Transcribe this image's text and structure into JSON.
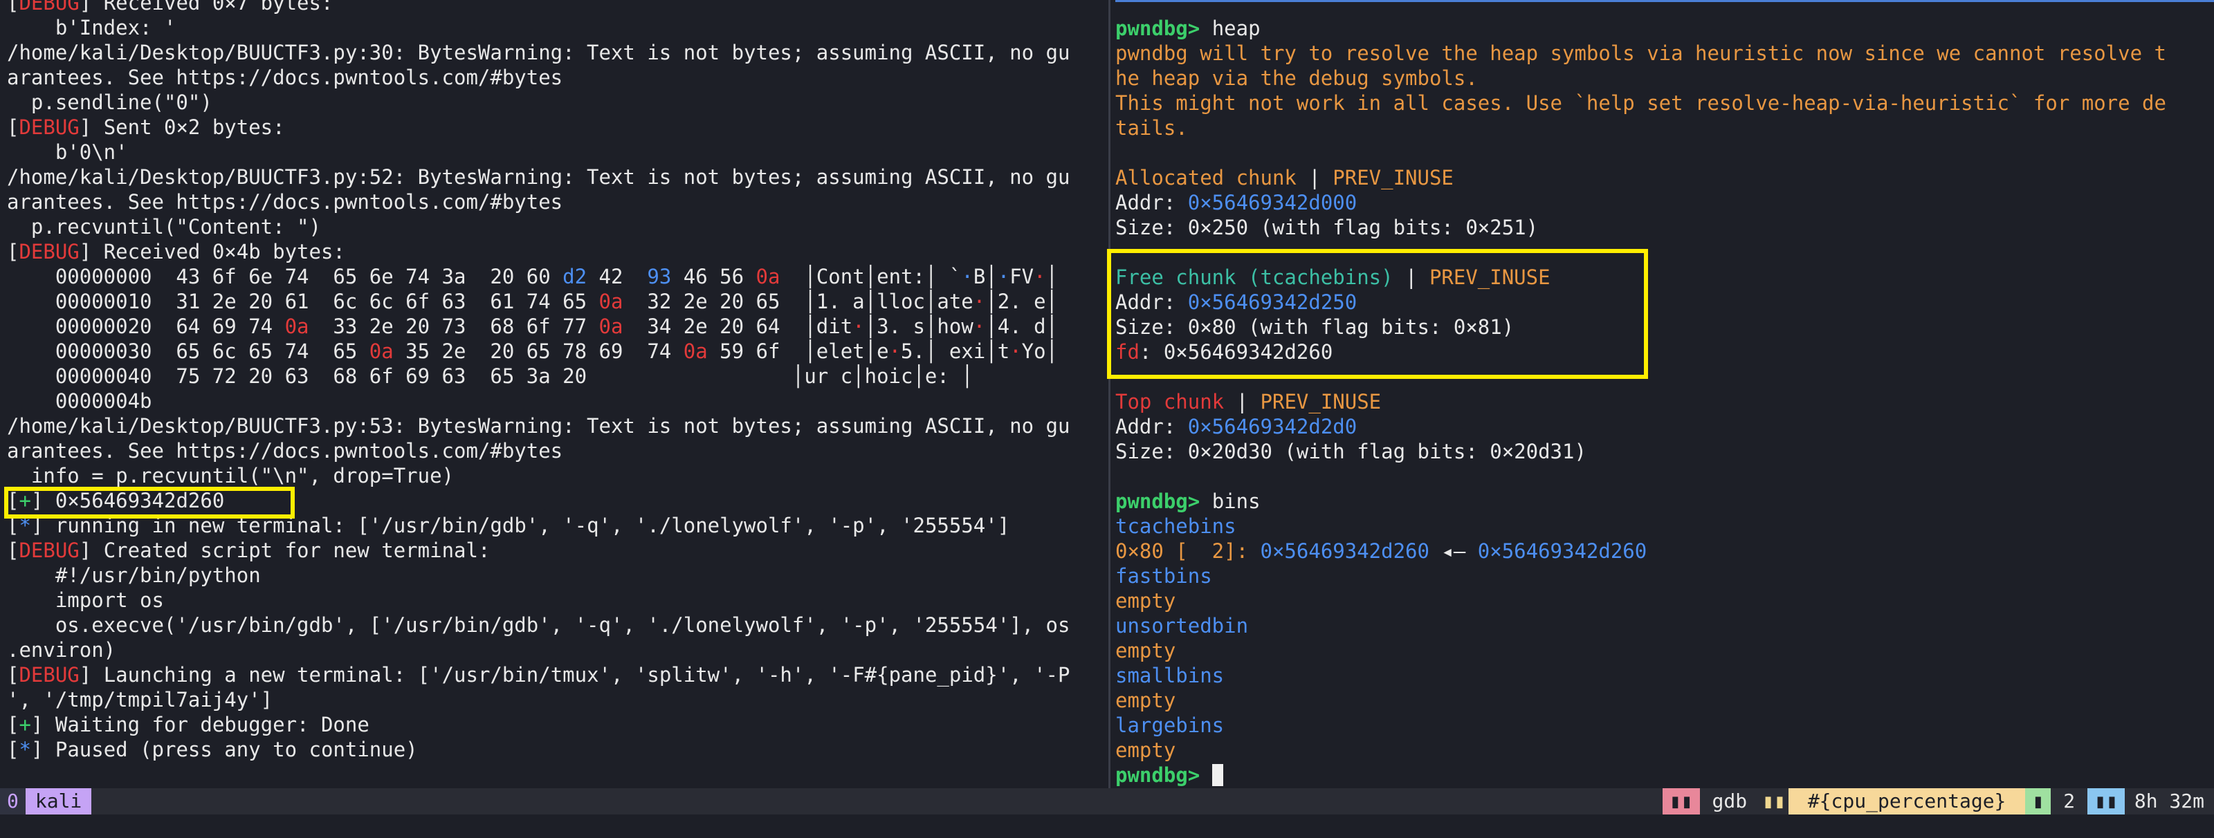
{
  "left_pane": {
    "lines": [
      [
        {
          "t": "[",
          "c": ""
        },
        {
          "t": "DEBUG",
          "c": "debug-tag"
        },
        {
          "t": "] Received 0×7 bytes:",
          "c": ""
        }
      ],
      [
        {
          "t": "    b'Index: '",
          "c": ""
        }
      ],
      [
        {
          "t": "/home/kali/Desktop/BUUCTF3.py:30: BytesWarning: Text is not bytes; assuming ASCII, no gu",
          "c": ""
        }
      ],
      [
        {
          "t": "arantees. See https://docs.pwntools.com/#bytes",
          "c": ""
        }
      ],
      [
        {
          "t": "  p.sendline(\"0\")",
          "c": ""
        }
      ],
      [
        {
          "t": "[",
          "c": ""
        },
        {
          "t": "DEBUG",
          "c": "debug-tag"
        },
        {
          "t": "] Sent 0×2 bytes:",
          "c": ""
        }
      ],
      [
        {
          "t": "    b'0\\n'",
          "c": ""
        }
      ],
      [
        {
          "t": "/home/kali/Desktop/BUUCTF3.py:52: BytesWarning: Text is not bytes; assuming ASCII, no gu",
          "c": ""
        }
      ],
      [
        {
          "t": "arantees. See https://docs.pwntools.com/#bytes",
          "c": ""
        }
      ],
      [
        {
          "t": "  p.recvuntil(\"Content: \")",
          "c": ""
        }
      ],
      [
        {
          "t": "[",
          "c": ""
        },
        {
          "t": "DEBUG",
          "c": "debug-tag"
        },
        {
          "t": "] Received 0×4b bytes:",
          "c": ""
        }
      ],
      [
        {
          "t": "    00000000  43 6f 6e 74  65 6e 74 3a  20 60 ",
          "c": ""
        },
        {
          "t": "d2",
          "c": "blue"
        },
        {
          "t": " 42  ",
          "c": ""
        },
        {
          "t": "93",
          "c": "blue"
        },
        {
          "t": " 46 56 ",
          "c": ""
        },
        {
          "t": "0a",
          "c": "red"
        },
        {
          "t": "  │Cont│ent:│ `",
          "c": ""
        },
        {
          "t": "·",
          "c": "blue"
        },
        {
          "t": "B│",
          "c": ""
        },
        {
          "t": "·",
          "c": "blue"
        },
        {
          "t": "FV",
          "c": ""
        },
        {
          "t": "·",
          "c": "red"
        },
        {
          "t": "│",
          "c": ""
        }
      ],
      [
        {
          "t": "    00000010  31 2e 20 61  6c 6c 6f 63  61 74 65 ",
          "c": ""
        },
        {
          "t": "0a",
          "c": "red"
        },
        {
          "t": "  32 2e 20 65  │1. a│lloc│ate",
          "c": ""
        },
        {
          "t": "·",
          "c": "red"
        },
        {
          "t": "│2. e│",
          "c": ""
        }
      ],
      [
        {
          "t": "    00000020  64 69 74 ",
          "c": ""
        },
        {
          "t": "0a",
          "c": "red"
        },
        {
          "t": "  33 2e 20 73  68 6f 77 ",
          "c": ""
        },
        {
          "t": "0a",
          "c": "red"
        },
        {
          "t": "  34 2e 20 64  │dit",
          "c": ""
        },
        {
          "t": "·",
          "c": "red"
        },
        {
          "t": "│3. s│how",
          "c": ""
        },
        {
          "t": "·",
          "c": "red"
        },
        {
          "t": "│4. d│",
          "c": ""
        }
      ],
      [
        {
          "t": "    00000030  65 6c 65 74  65 ",
          "c": ""
        },
        {
          "t": "0a",
          "c": "red"
        },
        {
          "t": " 35 2e  20 65 78 69  74 ",
          "c": ""
        },
        {
          "t": "0a",
          "c": "red"
        },
        {
          "t": " 59 6f  │elet│e",
          "c": ""
        },
        {
          "t": "·",
          "c": "red"
        },
        {
          "t": "5.│ exi│t",
          "c": ""
        },
        {
          "t": "·",
          "c": "red"
        },
        {
          "t": "Yo│",
          "c": ""
        }
      ],
      [
        {
          "t": "    00000040  75 72 20 63  68 6f 69 63  65 3a 20                 │ur c│hoic│e: │",
          "c": ""
        }
      ],
      [
        {
          "t": "    0000004b",
          "c": ""
        }
      ],
      [
        {
          "t": "/home/kali/Desktop/BUUCTF3.py:53: BytesWarning: Text is not bytes; assuming ASCII, no gu",
          "c": ""
        }
      ],
      [
        {
          "t": "arantees. See https://docs.pwntools.com/#bytes",
          "c": ""
        }
      ],
      [
        {
          "t": "  info = p.recvuntil(\"\\n\", drop=True)",
          "c": ""
        }
      ],
      [
        {
          "t": "[",
          "c": ""
        },
        {
          "t": "+",
          "c": "plus"
        },
        {
          "t": "] 0×56469342d260",
          "c": ""
        }
      ],
      [
        {
          "t": "[",
          "c": ""
        },
        {
          "t": "*",
          "c": "star"
        },
        {
          "t": "] running in new terminal: ['/usr/bin/gdb', '-q', './lonelywolf', '-p', '255554']",
          "c": ""
        }
      ],
      [
        {
          "t": "[",
          "c": ""
        },
        {
          "t": "DEBUG",
          "c": "debug-tag"
        },
        {
          "t": "] Created script for new terminal:",
          "c": ""
        }
      ],
      [
        {
          "t": "    #!/usr/bin/python",
          "c": ""
        }
      ],
      [
        {
          "t": "    import os",
          "c": ""
        }
      ],
      [
        {
          "t": "    os.execve('/usr/bin/gdb', ['/usr/bin/gdb', '-q', './lonelywolf', '-p', '255554'], os",
          "c": ""
        }
      ],
      [
        {
          "t": ".environ)",
          "c": ""
        }
      ],
      [
        {
          "t": "[",
          "c": ""
        },
        {
          "t": "DEBUG",
          "c": "debug-tag"
        },
        {
          "t": "] Launching a new terminal: ['/usr/bin/tmux', 'splitw', '-h', '-F#{pane_pid}', '-P",
          "c": ""
        }
      ],
      [
        {
          "t": "', '/tmp/tmpil7aij4y']",
          "c": ""
        }
      ],
      [
        {
          "t": "[",
          "c": ""
        },
        {
          "t": "+",
          "c": "plus"
        },
        {
          "t": "] Waiting for debugger: Done",
          "c": ""
        }
      ],
      [
        {
          "t": "[",
          "c": ""
        },
        {
          "t": "*",
          "c": "star"
        },
        {
          "t": "] Paused (press any to continue)",
          "c": ""
        }
      ]
    ]
  },
  "right_pane": {
    "lines": [
      [
        {
          "t": "pwndbg> ",
          "c": "prompt"
        },
        {
          "t": "heap",
          "c": ""
        }
      ],
      [
        {
          "t": "pwndbg will try to resolve the heap symbols via heuristic now since we cannot resolve t",
          "c": "orange"
        }
      ],
      [
        {
          "t": "he heap via the debug symbols.",
          "c": "orange"
        }
      ],
      [
        {
          "t": "This might not work in all cases. Use `help set resolve-heap-via-heuristic` for more de",
          "c": "orange"
        }
      ],
      [
        {
          "t": "tails.",
          "c": "orange"
        }
      ],
      [
        {
          "t": "",
          "c": ""
        }
      ],
      [
        {
          "t": "Allocated chunk",
          "c": "orange"
        },
        {
          "t": " | ",
          "c": ""
        },
        {
          "t": "PREV_INUSE",
          "c": "orange"
        }
      ],
      [
        {
          "t": "Addr: ",
          "c": ""
        },
        {
          "t": "0×56469342d000",
          "c": "blue"
        }
      ],
      [
        {
          "t": "Size: 0×250 (with flag bits: 0×251)",
          "c": ""
        }
      ],
      [
        {
          "t": "",
          "c": ""
        }
      ],
      [
        {
          "t": "Free chunk (tcachebins)",
          "c": "teal"
        },
        {
          "t": " | ",
          "c": ""
        },
        {
          "t": "PREV_INUSE",
          "c": "orange"
        }
      ],
      [
        {
          "t": "Addr: ",
          "c": ""
        },
        {
          "t": "0×56469342d250",
          "c": "blue"
        }
      ],
      [
        {
          "t": "Size: 0×80 (with flag bits: 0×81)",
          "c": ""
        }
      ],
      [
        {
          "t": "fd",
          "c": "red"
        },
        {
          "t": ": 0×56469342d260",
          "c": ""
        }
      ],
      [
        {
          "t": "",
          "c": ""
        }
      ],
      [
        {
          "t": "Top chunk",
          "c": "red"
        },
        {
          "t": " | ",
          "c": ""
        },
        {
          "t": "PREV_INUSE",
          "c": "orange"
        }
      ],
      [
        {
          "t": "Addr: ",
          "c": ""
        },
        {
          "t": "0×56469342d2d0",
          "c": "blue"
        }
      ],
      [
        {
          "t": "Size: 0×20d30 (with flag bits: 0×20d31)",
          "c": ""
        }
      ],
      [
        {
          "t": "",
          "c": ""
        }
      ],
      [
        {
          "t": "pwndbg> ",
          "c": "prompt"
        },
        {
          "t": "bins",
          "c": ""
        }
      ],
      [
        {
          "t": "tcachebins",
          "c": "blue"
        }
      ],
      [
        {
          "t": "0×80 [  2]: ",
          "c": "orange"
        },
        {
          "t": "0×56469342d260",
          "c": "blue"
        },
        {
          "t": " ◂— ",
          "c": ""
        },
        {
          "t": "0×56469342d260",
          "c": "blue"
        }
      ],
      [
        {
          "t": "fastbins",
          "c": "blue"
        }
      ],
      [
        {
          "t": "empty",
          "c": "orange"
        }
      ],
      [
        {
          "t": "unsortedbin",
          "c": "blue"
        }
      ],
      [
        {
          "t": "empty",
          "c": "orange"
        }
      ],
      [
        {
          "t": "smallbins",
          "c": "blue"
        }
      ],
      [
        {
          "t": "empty",
          "c": "orange"
        }
      ],
      [
        {
          "t": "largebins",
          "c": "blue"
        }
      ],
      [
        {
          "t": "empty",
          "c": "orange"
        }
      ],
      [
        {
          "t": "pwndbg> ",
          "c": "prompt"
        },
        {
          "t": "",
          "c": ""
        }
      ]
    ]
  },
  "status_bar": {
    "window_index": "0",
    "session_name": "kali",
    "command_name": "gdb",
    "cpu_label": "#{cpu_percentage}",
    "window_count": "2",
    "uptime": "8h 32m"
  },
  "colors": {
    "debug": "#e23a3a",
    "plus": "#3ccf6b",
    "star": "#4d8ff2",
    "address_blue": "#4d8ff2",
    "orange": "#e89742",
    "teal": "#3cbfa5",
    "highlight_box": "#ffee00"
  }
}
